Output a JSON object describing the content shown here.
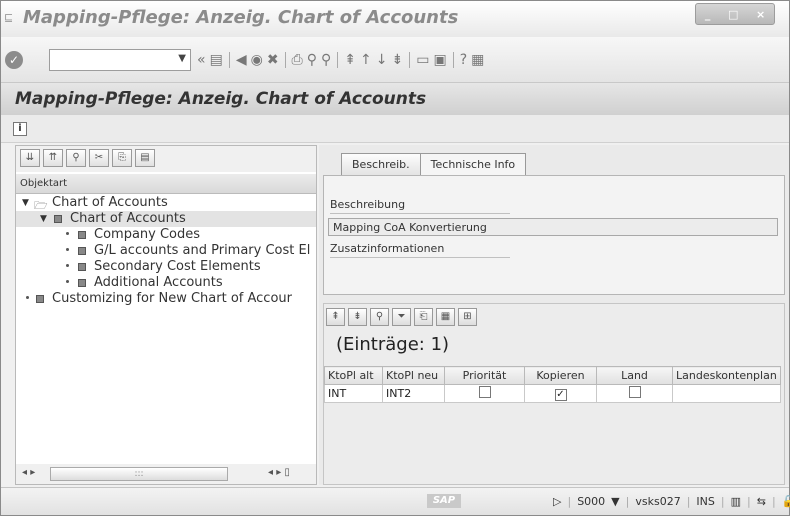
{
  "window": {
    "title": "Mapping-Pflege: Anzeig. Chart of Accounts",
    "controls": [
      "_",
      "□",
      "×"
    ]
  },
  "toolbar": {
    "command_field_value": "",
    "icons": [
      "enter-icon",
      "save-icon",
      "back-icon",
      "exit-icon",
      "cancel-icon",
      "print-icon",
      "find-icon",
      "find-next-icon",
      "first-page-icon",
      "prev-page-icon",
      "next-page-icon",
      "last-page-icon",
      "create-session-icon",
      "shortcut-icon",
      "help-icon",
      "customize-layout-icon"
    ]
  },
  "page": {
    "title": "Mapping-Pflege: Anzeig. Chart of Accounts"
  },
  "tree": {
    "column_header": "Objektart",
    "nodes": [
      {
        "label": "Chart of Accounts",
        "level": 0,
        "expanded": true,
        "type": "folder"
      },
      {
        "label": "Chart of Accounts",
        "level": 1,
        "expanded": true,
        "type": "leaf",
        "selected": true
      },
      {
        "label": "Company Codes",
        "level": 2,
        "type": "leaf"
      },
      {
        "label": "G/L accounts and Primary Cost El",
        "level": 2,
        "type": "leaf"
      },
      {
        "label": "Secondary Cost Elements",
        "level": 2,
        "type": "leaf"
      },
      {
        "label": "Additional Accounts",
        "level": 2,
        "type": "leaf"
      },
      {
        "label": "Customizing for New Chart of Accour",
        "level": 0,
        "type": "leaf"
      }
    ],
    "scroll_grip": ":::"
  },
  "detail": {
    "tabs": [
      {
        "label": "Beschreib.",
        "active": true
      },
      {
        "label": "Technische Info",
        "active": false
      }
    ],
    "beschreibung_label": "Beschreibung",
    "beschreibung_value": "Mapping CoA Konvertierung",
    "zusatz_label": "Zusatzinformationen"
  },
  "alv": {
    "title": "(Einträge: 1)",
    "columns": [
      "KtoPl alt",
      "KtoPl neu",
      "Priorität",
      "Kopieren",
      "Land",
      "Landeskontenplan"
    ],
    "rows": [
      {
        "ktopl_alt": "INT",
        "ktopl_neu": "INT2",
        "prioritaet": false,
        "kopieren": true,
        "land": false,
        "landeskontenplan": ""
      }
    ]
  },
  "status": {
    "system": "S000",
    "server": "vsks027",
    "mode": "INS",
    "logo": "SAP"
  }
}
